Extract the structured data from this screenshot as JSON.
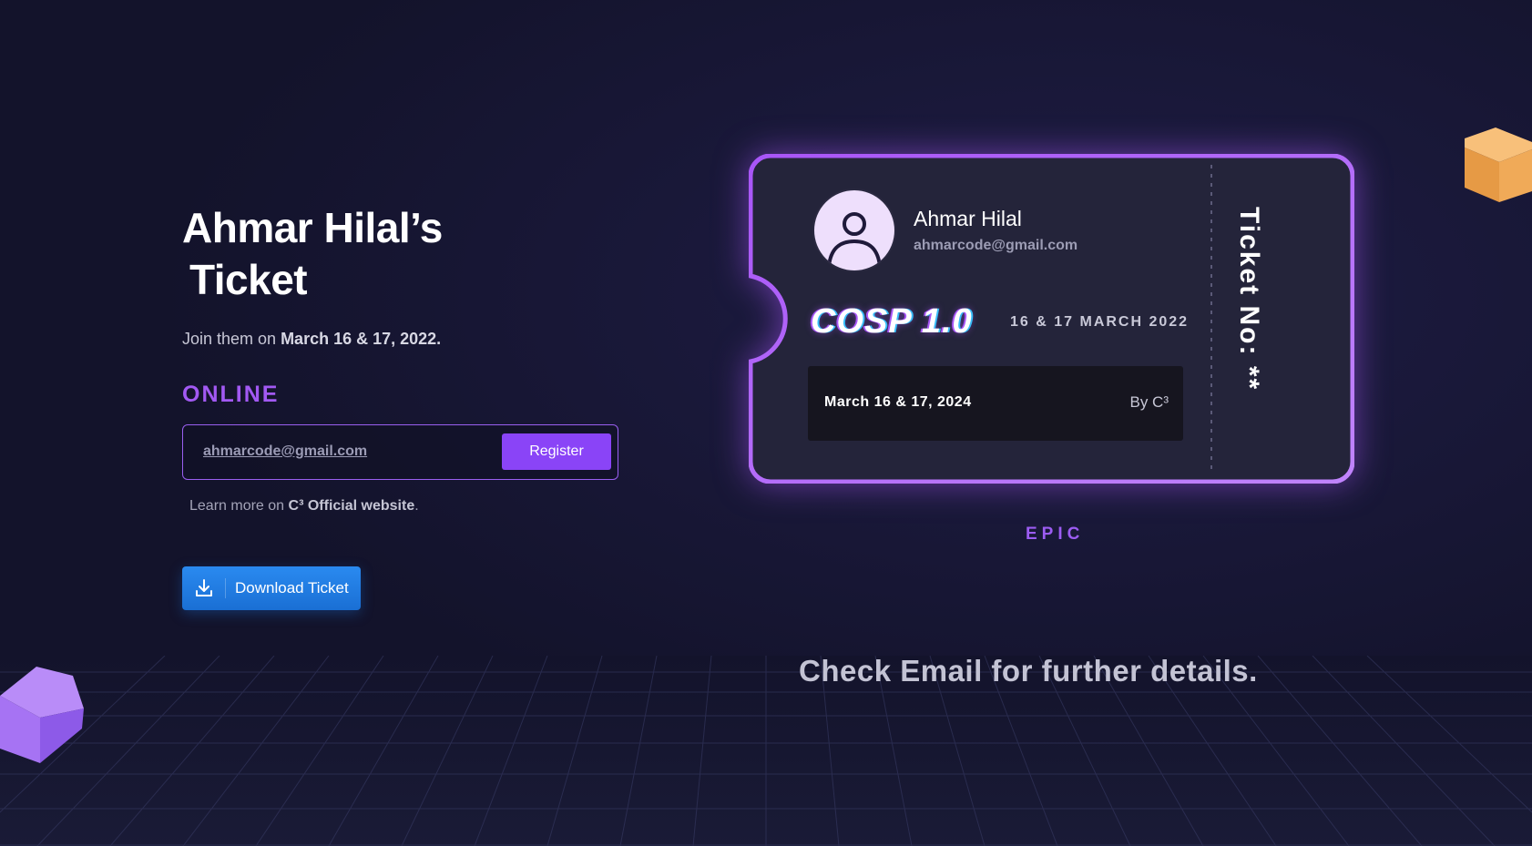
{
  "page": {
    "title_line1": "Ahmar Hilal’s",
    "title_line2": "Ticket",
    "join_prefix": "Join them on ",
    "join_date": "March 16 & 17, 2022.",
    "online_label": "ONLINE",
    "register": {
      "email_value": "ahmarcode@gmail.com",
      "button_label": "Register"
    },
    "learn_prefix": "Learn more on ",
    "learn_link": "C³ Official website",
    "learn_suffix": ".",
    "download_label": "Download Ticket"
  },
  "ticket": {
    "name": "Ahmar Hilal",
    "email": "ahmarcode@gmail.com",
    "event": "COSP 1.0",
    "event_date": "16 & 17 MARCH 2022",
    "strip_date": "March 16 & 17, 2024",
    "strip_by": "By C³",
    "ticket_no": "Ticket No: **",
    "tier": "EPIC",
    "border_color_start": "#a855f7",
    "border_color_end": "#c084fc"
  },
  "footer": {
    "message": "Check Email for further details."
  },
  "icons": {
    "download": "download-icon",
    "avatar": "user-avatar-icon",
    "decor_top": "orange-cube-icon",
    "decor_bottom": "purple-cube-icon"
  }
}
